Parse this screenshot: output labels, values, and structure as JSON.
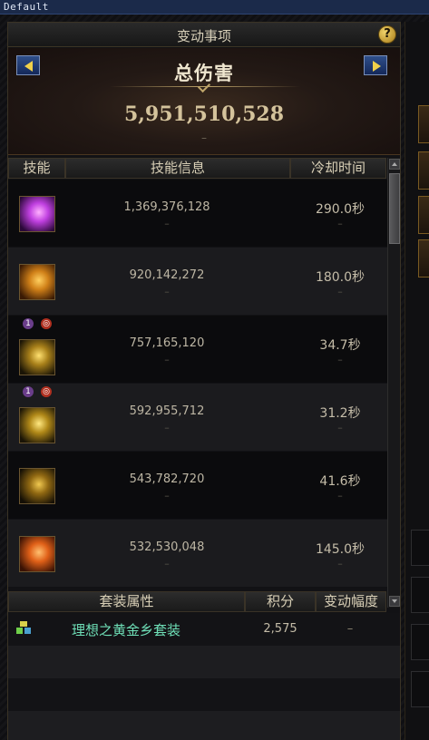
{
  "window": {
    "title": "Default"
  },
  "panel": {
    "title": "变动事项",
    "help_label": "?",
    "damage": {
      "label": "总伤害",
      "value": "5,951,510,528",
      "delta": "–"
    }
  },
  "columns": {
    "skill": "技能",
    "info": "技能信息",
    "cooldown": "冷却时间"
  },
  "skills": [
    {
      "icon": "purple-energy-skill-icon",
      "damage": "1,369,376,128",
      "cooldown": "290.0秒",
      "delta_damage": "–",
      "delta_cooldown": "–",
      "badges": false
    },
    {
      "icon": "golden-fist-skill-icon",
      "damage": "920,142,272",
      "cooldown": "180.0秒",
      "delta_damage": "–",
      "delta_cooldown": "–",
      "badges": false
    },
    {
      "icon": "golden-burst-skill-icon",
      "damage": "757,165,120",
      "cooldown": "34.7秒",
      "delta_damage": "–",
      "delta_cooldown": "–",
      "badges": true,
      "badge_left": "1"
    },
    {
      "icon": "golden-explosion-skill-icon",
      "damage": "592,955,712",
      "cooldown": "31.2秒",
      "delta_damage": "–",
      "delta_cooldown": "–",
      "badges": true,
      "badge_left": "1"
    },
    {
      "icon": "golden-slash-skill-icon",
      "damage": "543,782,720",
      "cooldown": "41.6秒",
      "delta_damage": "–",
      "delta_cooldown": "–",
      "badges": false
    },
    {
      "icon": "orange-flame-skill-icon",
      "damage": "532,530,048",
      "cooldown": "145.0秒",
      "delta_damage": "–",
      "delta_cooldown": "–",
      "badges": false
    }
  ],
  "set_columns": {
    "set": "套装属性",
    "score": "积分",
    "change": "变动幅度"
  },
  "sets": [
    {
      "icon": "set-equipment-icon",
      "name": "理想之黄金乡套装",
      "score": "2,575",
      "change": "–"
    }
  ],
  "colors": {
    "set_name": "#6fe0b8",
    "accent_gold": "#d4c39c",
    "arrow_button": "#2f4f8a"
  }
}
